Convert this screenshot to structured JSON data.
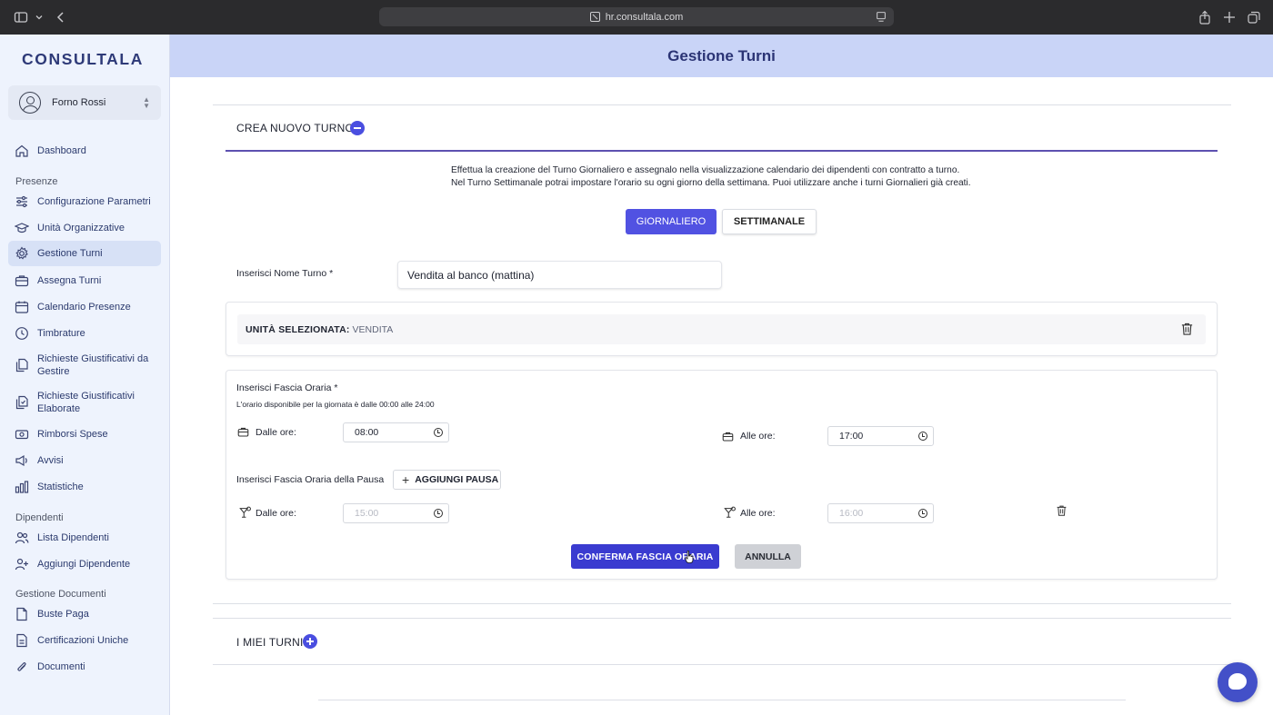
{
  "browser": {
    "url": "hr.consultala.com"
  },
  "sidebar": {
    "logo": "CONSULTALA",
    "company": "Forno Rossi",
    "dashboard": "Dashboard",
    "sections": {
      "presenze": "Presenze",
      "dipendenti": "Dipendenti",
      "documenti": "Gestione Documenti"
    },
    "items": {
      "configurazione": "Configurazione Parametri",
      "unita": "Unità Organizzative",
      "gestione_turni": "Gestione Turni",
      "assegna_turni": "Assegna Turni",
      "calendario": "Calendario Presenze",
      "timbrature": "Timbrature",
      "richieste_gestire": "Richieste Giustificativi da Gestire",
      "richieste_elaborate": "Richieste Giustificativi Elaborate",
      "rimborsi": "Rimborsi Spese",
      "avvisi": "Avvisi",
      "statistiche": "Statistiche",
      "lista_dipendenti": "Lista Dipendenti",
      "aggiungi_dipendente": "Aggiungi Dipendente",
      "buste_paga": "Buste Paga",
      "certificazioni": "Certificazioni Uniche",
      "documenti": "Documenti"
    },
    "active": "gestione_turni"
  },
  "header": {
    "title": "Gestione Turni"
  },
  "crea": {
    "title": "CREA NUOVO TURNO",
    "desc_line1": "Effettua la creazione del Turno Giornaliero e assegnalo nella visualizzazione calendario dei dipendenti con contratto a turno.",
    "desc_line2": "Nel Turno Settimanale potrai impostare l'orario su ogni giorno della settimana. Puoi utilizzare anche i turni Giornalieri già creati.",
    "tab_giornaliero": "GIORNALIERO",
    "tab_settimanale": "SETTIMANALE",
    "active_tab": "GIORNALIERO",
    "nome_label": "Inserisci Nome Turno *",
    "nome_value": "Vendita al banco (mattina)",
    "unita_label": "UNITÀ SELEZIONATA:",
    "unita_value": "VENDITA",
    "fascia_label": "Inserisci Fascia Oraria *",
    "fascia_hint": "L'orario disponibile per la giornata è dalle 00:00 alle 24:00",
    "dalle_label": "Dalle ore:",
    "alle_label": "Alle ore:",
    "dalle_value": "08:00",
    "alle_value": "17:00",
    "pausa_label": "Inserisci Fascia Oraria della Pausa",
    "aggiungi_pausa": "AGGIUNGI PAUSA",
    "pausa_dalle_label": "Dalle ore:",
    "pausa_alle_label": "Alle ore:",
    "pausa_dalle_value": "15:00",
    "pausa_alle_value": "16:00",
    "conferma": "CONFERMA FASCIA ORARIA",
    "annulla": "ANNULLA"
  },
  "miei": {
    "title": "I MIEI TURNI"
  },
  "colors": {
    "accent": "#5152e2",
    "header_bg": "#c9d4f7",
    "sidebar_bg": "#eef3fd"
  }
}
